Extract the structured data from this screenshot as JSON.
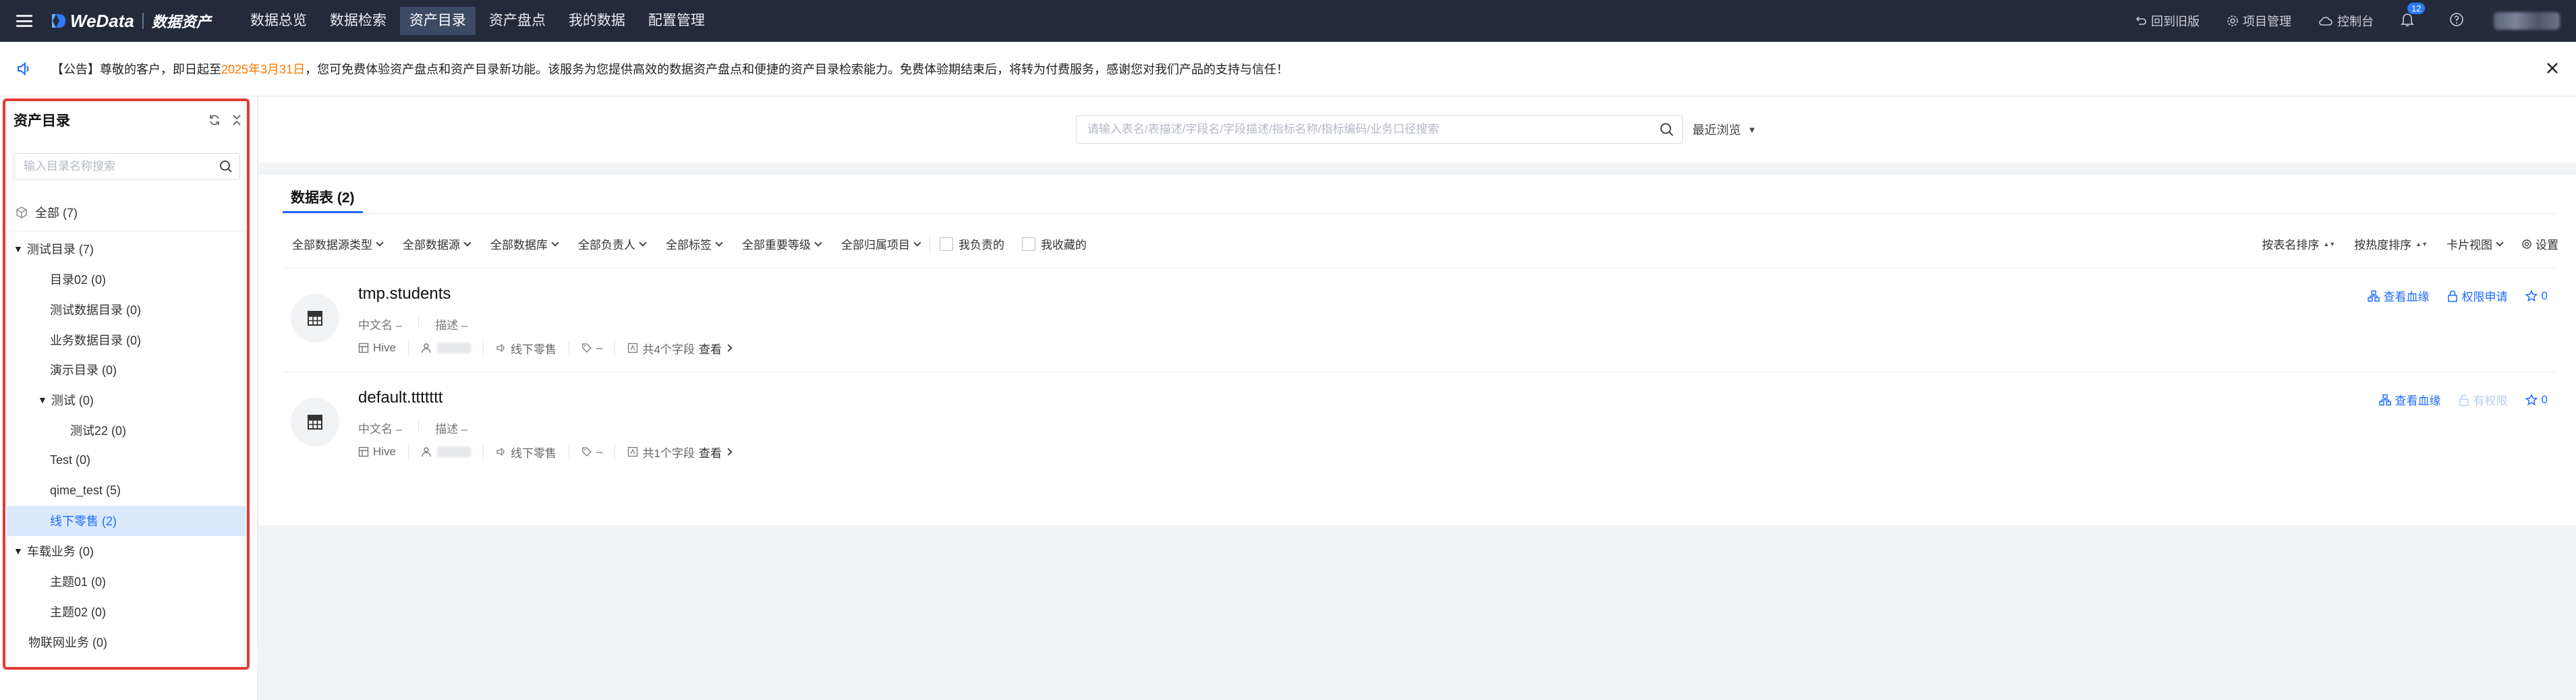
{
  "header": {
    "logo_text": "WeData",
    "logo_sub": "数据资产",
    "nav": [
      "数据总览",
      "数据检索",
      "资产目录",
      "资产盘点",
      "我的数据",
      "配置管理"
    ],
    "active_nav_index": 2,
    "right": {
      "back_old": "回到旧版",
      "project_mgmt": "项目管理",
      "console": "控制台",
      "notification_count": "12"
    }
  },
  "notice": {
    "prefix": "【公告】尊敬的客户，即日起至",
    "date": "2025年3月31日",
    "suffix": "，您可免费体验资产盘点和资产目录新功能。该服务为您提供高效的数据资产盘点和便捷的资产目录检索能力。免费体验期结束后，将转为付费服务，感谢您对我们产品的支持与信任！"
  },
  "sidebar": {
    "title": "资产目录",
    "search_placeholder": "输入目录名称搜索",
    "all_label": "全部 (7)",
    "tree": [
      {
        "label": "测试目录 (7)",
        "level": 0,
        "expanded": true
      },
      {
        "label": "目录02 (0)",
        "level": 1
      },
      {
        "label": "测试数据目录 (0)",
        "level": 1
      },
      {
        "label": "业务数据目录 (0)",
        "level": 1
      },
      {
        "label": "演示目录 (0)",
        "level": 1
      },
      {
        "label": "测试 (0)",
        "level": 1,
        "expanded": true
      },
      {
        "label": "测试22 (0)",
        "level": 2
      },
      {
        "label": "Test (0)",
        "level": 1
      },
      {
        "label": "qime_test (5)",
        "level": 1
      },
      {
        "label": "线下零售 (2)",
        "level": 1,
        "selected": true
      },
      {
        "label": "车载业务 (0)",
        "level": 0,
        "expanded": true
      },
      {
        "label": "主题01 (0)",
        "level": 1
      },
      {
        "label": "主题02 (0)",
        "level": 1
      },
      {
        "label": "物联网业务 (0)",
        "level": 0
      }
    ]
  },
  "main": {
    "search_placeholder": "请输入表名/表描述/字段名/字段描述/指标名称/指标编码/业务口径搜索",
    "recent_label": "最近浏览",
    "tab_label": "数据表 (2)",
    "filters": [
      "全部数据源类型",
      "全部数据源",
      "全部数据库",
      "全部负责人",
      "全部标签",
      "全部重要等级",
      "全部归属项目"
    ],
    "checks": [
      "我负责的",
      "我收藏的"
    ],
    "right_controls": {
      "sort_name": "按表名排序",
      "sort_hot": "按热度排序",
      "view_mode": "卡片视图",
      "settings": "设置"
    },
    "cards": [
      {
        "title": "tmp.students",
        "cn_name": "中文名 –",
        "desc": "描述 –",
        "source": "Hive",
        "catalog": "线下零售",
        "tag": "–",
        "fields": "共4个字段",
        "view": "查看",
        "lineage": "查看血缘",
        "permission": "权限申请",
        "permission_disabled": false,
        "stars": "0"
      },
      {
        "title": "default.ttttttt",
        "cn_name": "中文名 –",
        "desc": "描述 –",
        "source": "Hive",
        "catalog": "线下零售",
        "tag": "–",
        "fields": "共1个字段",
        "view": "查看",
        "lineage": "查看血缘",
        "permission": "有权限",
        "permission_disabled": true,
        "stars": "0"
      }
    ]
  },
  "colors": {
    "topbar_bg": "#232b3b",
    "accent": "#1f6bff",
    "notice_date": "#ff7a00",
    "highlight_frame": "#e53935"
  }
}
